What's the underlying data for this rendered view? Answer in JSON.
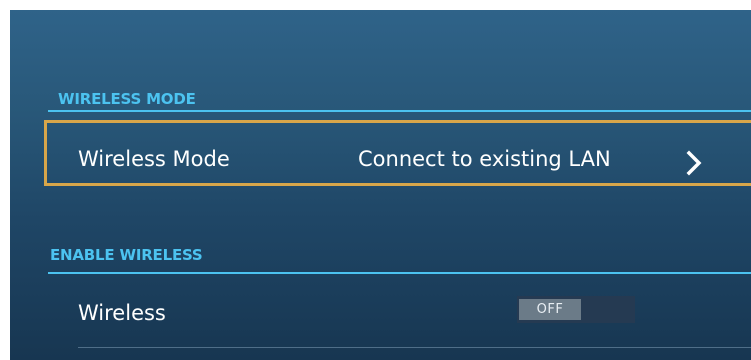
{
  "wireless_mode_section": {
    "header": "WIRELESS MODE",
    "row_label": "Wireless Mode",
    "row_value": "Connect to existing LAN"
  },
  "enable_wireless_section": {
    "header": "ENABLE WIRELESS",
    "row_label": "Wireless",
    "toggle_state": "OFF"
  },
  "icons": {
    "row_arrow": "chevron-right-icon"
  },
  "colors": {
    "section_header": "#4cc3f0",
    "focus_border": "#d8a64a",
    "text": "#ffffff"
  }
}
